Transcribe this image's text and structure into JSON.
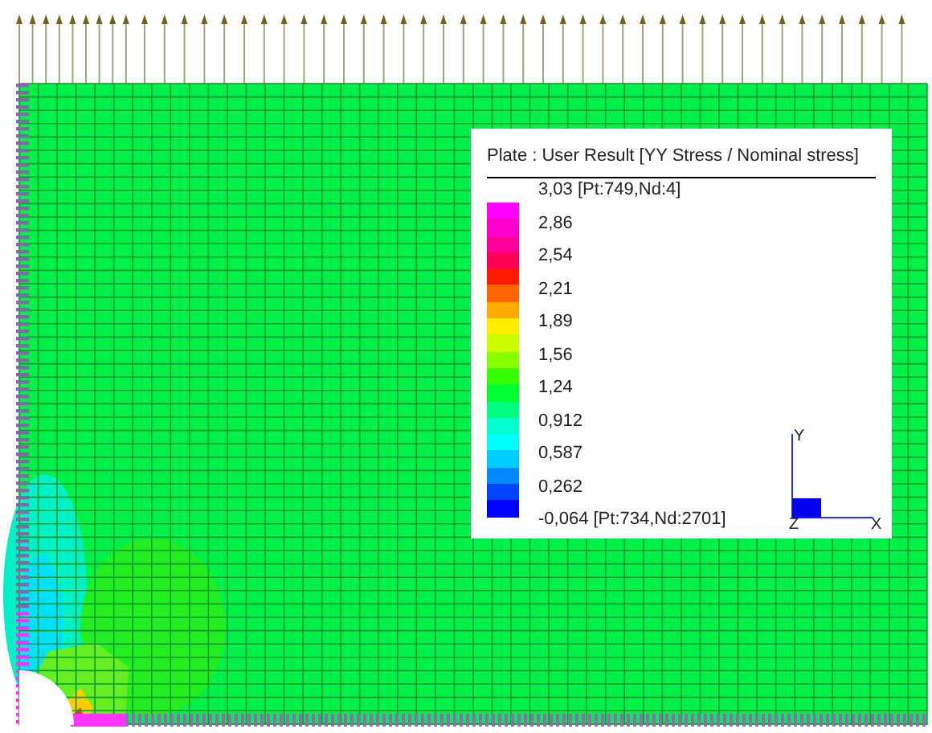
{
  "legend": {
    "title": "Plate : User Result [YY Stress / Nominal stress]",
    "max_label": "3,03 [Pt:749,Nd:4]",
    "min_label": "-0,064 [Pt:734,Nd:2701]",
    "labels": [
      "2,86",
      "2,54",
      "2,21",
      "1,89",
      "1,56",
      "1,24",
      "0,912",
      "0,587",
      "0,262"
    ],
    "bands": [
      {
        "color": "#ff00ff"
      },
      {
        "color": "#ff00cc"
      },
      {
        "color": "#ff0099"
      },
      {
        "color": "#ff0055"
      },
      {
        "color": "#ff1a00"
      },
      {
        "color": "#ff6600"
      },
      {
        "color": "#ffaa00"
      },
      {
        "color": "#ffee00"
      },
      {
        "color": "#ccff00"
      },
      {
        "color": "#88ff00"
      },
      {
        "color": "#33ff00"
      },
      {
        "color": "#00ff33"
      },
      {
        "color": "#00ff80"
      },
      {
        "color": "#00ffcc"
      },
      {
        "color": "#00ffff"
      },
      {
        "color": "#00ccff"
      },
      {
        "color": "#0088ff"
      },
      {
        "color": "#0044ff"
      },
      {
        "color": "#0000ff"
      }
    ]
  },
  "axes": {
    "y": "Y",
    "z": "Z",
    "x": "X"
  }
}
